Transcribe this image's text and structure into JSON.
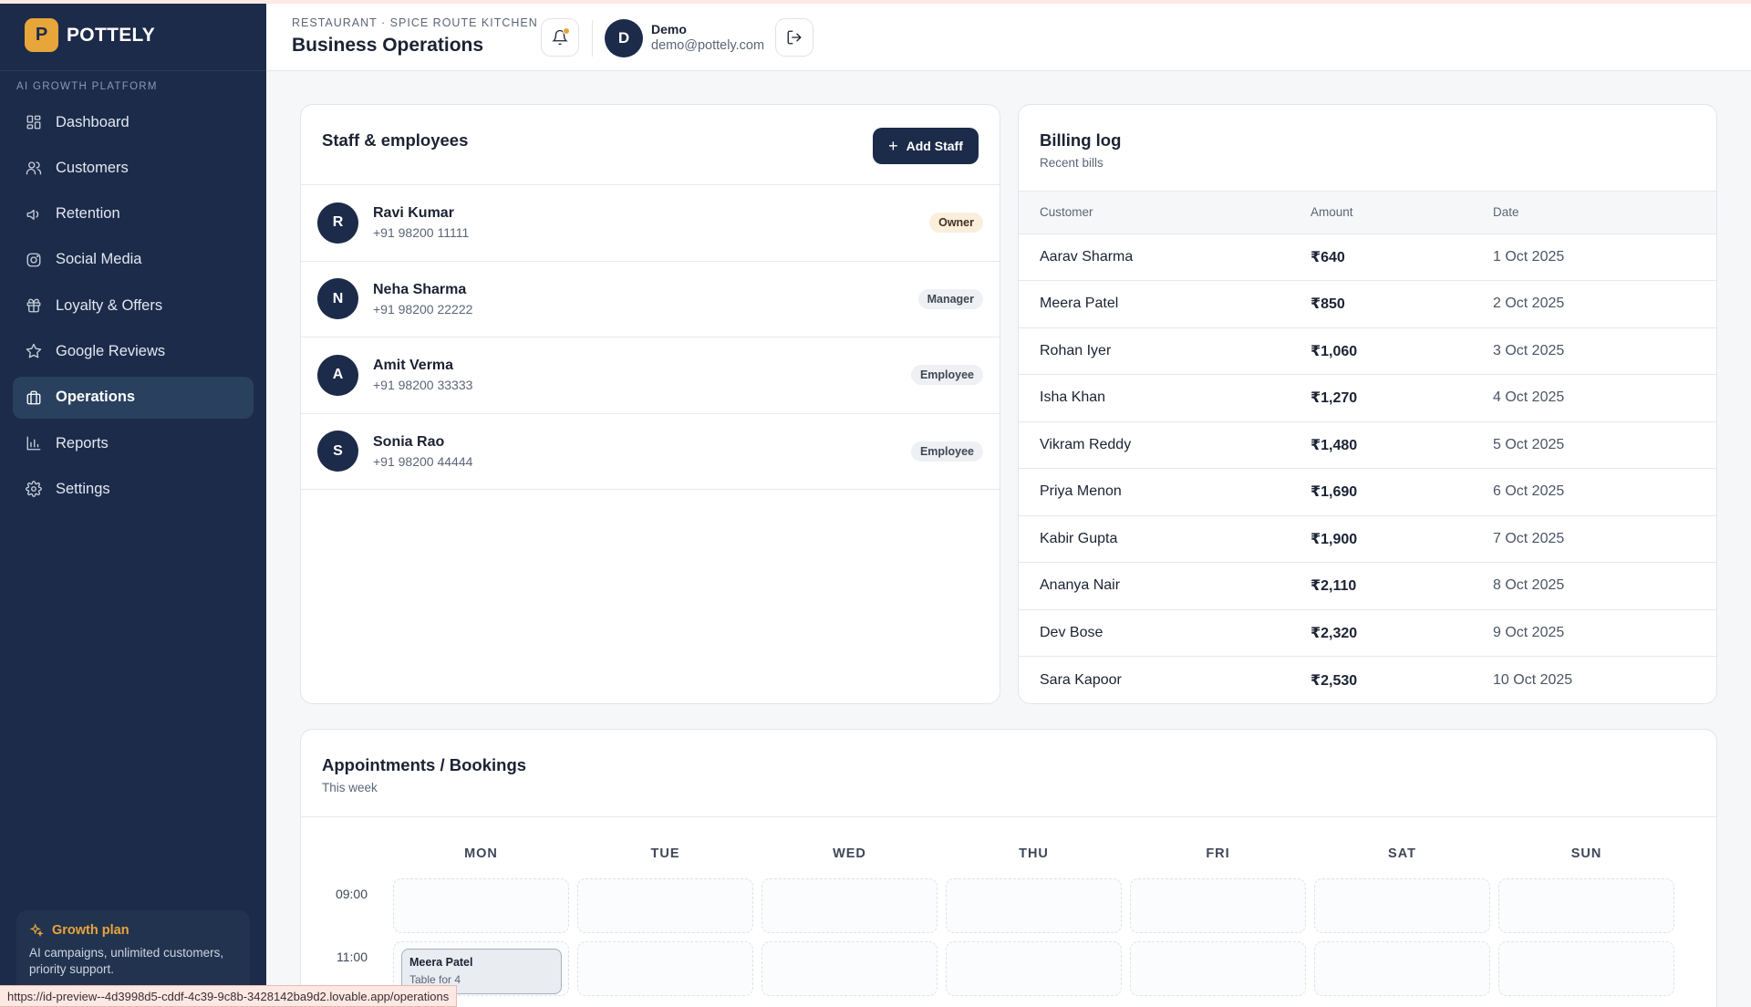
{
  "app": {
    "logo_letter": "P",
    "name": "POTTELY",
    "tagline": "AI GROWTH PLATFORM"
  },
  "sidebar": {
    "items": [
      {
        "label": "Dashboard",
        "icon": "dashboard-icon"
      },
      {
        "label": "Customers",
        "icon": "users-icon"
      },
      {
        "label": "Retention",
        "icon": "megaphone-icon"
      },
      {
        "label": "Social Media",
        "icon": "instagram-icon"
      },
      {
        "label": "Loyalty & Offers",
        "icon": "gift-icon"
      },
      {
        "label": "Google Reviews",
        "icon": "star-icon"
      },
      {
        "label": "Operations",
        "icon": "briefcase-icon",
        "active": true
      },
      {
        "label": "Reports",
        "icon": "bar-chart-icon"
      },
      {
        "label": "Settings",
        "icon": "gear-icon"
      }
    ],
    "plan": {
      "title": "Growth plan",
      "description": "AI campaigns, unlimited customers, priority support."
    }
  },
  "header": {
    "eyebrow": "RESTAURANT · SPICE ROUTE KITCHEN",
    "title": "Business Operations",
    "user": {
      "initial": "D",
      "name": "Demo",
      "email": "demo@pottely.com"
    }
  },
  "staff": {
    "title": "Staff & employees",
    "add_label": "Add Staff",
    "members": [
      {
        "initial": "R",
        "name": "Ravi Kumar",
        "phone": "+91 98200 11111",
        "role": "Owner"
      },
      {
        "initial": "N",
        "name": "Neha Sharma",
        "phone": "+91 98200 22222",
        "role": "Manager"
      },
      {
        "initial": "A",
        "name": "Amit Verma",
        "phone": "+91 98200 33333",
        "role": "Employee"
      },
      {
        "initial": "S",
        "name": "Sonia Rao",
        "phone": "+91 98200 44444",
        "role": "Employee"
      }
    ]
  },
  "billing": {
    "title": "Billing log",
    "subtitle": "Recent bills",
    "columns": [
      "Customer",
      "Amount",
      "Date"
    ],
    "rows": [
      {
        "customer": "Aarav Sharma",
        "amount": "₹640",
        "date": "1 Oct 2025"
      },
      {
        "customer": "Meera Patel",
        "amount": "₹850",
        "date": "2 Oct 2025"
      },
      {
        "customer": "Rohan Iyer",
        "amount": "₹1,060",
        "date": "3 Oct 2025"
      },
      {
        "customer": "Isha Khan",
        "amount": "₹1,270",
        "date": "4 Oct 2025"
      },
      {
        "customer": "Vikram Reddy",
        "amount": "₹1,480",
        "date": "5 Oct 2025"
      },
      {
        "customer": "Priya Menon",
        "amount": "₹1,690",
        "date": "6 Oct 2025"
      },
      {
        "customer": "Kabir Gupta",
        "amount": "₹1,900",
        "date": "7 Oct 2025"
      },
      {
        "customer": "Ananya Nair",
        "amount": "₹2,110",
        "date": "8 Oct 2025"
      },
      {
        "customer": "Dev Bose",
        "amount": "₹2,320",
        "date": "9 Oct 2025"
      },
      {
        "customer": "Sara Kapoor",
        "amount": "₹2,530",
        "date": "10 Oct 2025"
      }
    ]
  },
  "appointments": {
    "title": "Appointments / Bookings",
    "subtitle": "This week",
    "days": [
      "MON",
      "TUE",
      "WED",
      "THU",
      "FRI",
      "SAT",
      "SUN"
    ],
    "times": [
      "09:00",
      "11:00"
    ],
    "booking": {
      "name": "Meera Patel",
      "detail": "Table for 4"
    }
  },
  "status_url": "https://id-preview--4d3998d5-cddf-4c39-9c8b-3428142ba9d2.lovable.app/operations",
  "colors": {
    "sidebar_bg": "#1c2b49",
    "accent": "#e8a53a",
    "active_nav": "#29405f"
  }
}
